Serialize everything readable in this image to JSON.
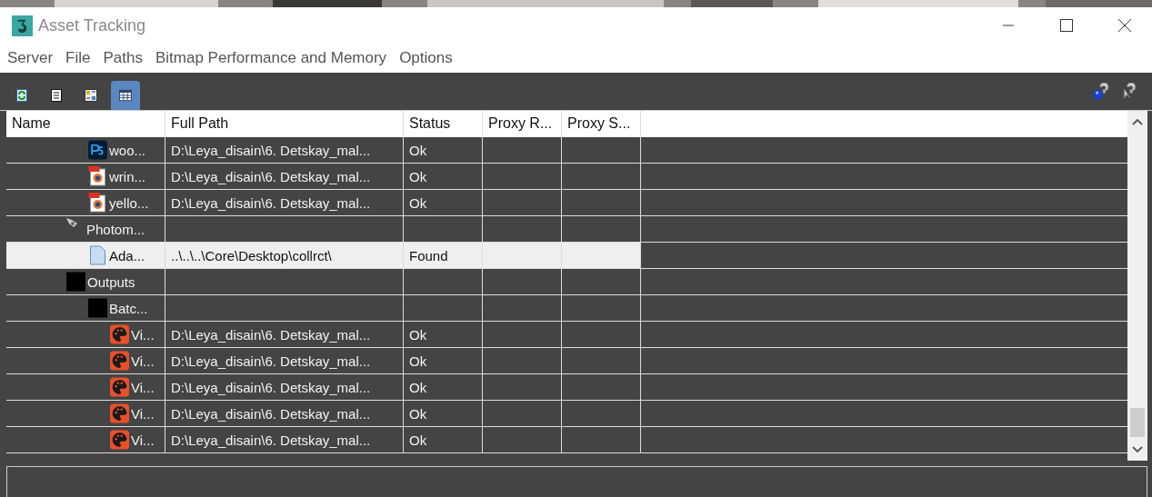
{
  "window": {
    "title": "Asset Tracking"
  },
  "menu": [
    "Server",
    "File",
    "Paths",
    "Bitmap Performance and Memory",
    "Options"
  ],
  "toolbar": [
    {
      "kind": "refresh",
      "selected": false
    },
    {
      "kind": "list",
      "selected": false
    },
    {
      "kind": "thumbnails",
      "selected": false
    },
    {
      "kind": "grid",
      "selected": true
    }
  ],
  "help_buttons": [
    {
      "kind": "online-help"
    },
    {
      "kind": "context-help"
    }
  ],
  "table": {
    "columns": [
      "Name",
      "Full Path",
      "Status",
      "Proxy R...",
      "Proxy S..."
    ],
    "rows": [
      {
        "kind": "continued",
        "children": [
          {
            "kind": "photoshop",
            "name": "woo...",
            "path": "D:\\Leya_disain\\6. Detskay_mal...",
            "status": "Ok",
            "selected": false
          },
          {
            "kind": "jpeg",
            "name": "wrin...",
            "path": "D:\\Leya_disain\\6. Detskay_mal...",
            "status": "Ok",
            "selected": false
          },
          {
            "kind": "jpeg",
            "name": "yello...",
            "path": "D:\\Leya_disain\\6. Detskay_mal...",
            "status": "Ok",
            "selected": false
          }
        ]
      },
      {
        "kind": "photometric",
        "name": "Photom...",
        "selected": false,
        "children": [
          {
            "kind": "document",
            "name": "Ada...",
            "path": "..\\..\\..\\Core\\Desktop\\collrct\\",
            "status": "Found",
            "selected": true
          }
        ]
      },
      {
        "kind": "black",
        "name": "Outputs",
        "selected": false,
        "children": [
          {
            "kind": "black",
            "name": "Batc...",
            "selected": false,
            "children": [
              {
                "kind": "palette",
                "name": "Vi...",
                "path": "D:\\Leya_disain\\6. Detskay_mal...",
                "status": "Ok",
                "selected": false
              },
              {
                "kind": "palette",
                "name": "Vi...",
                "path": "D:\\Leya_disain\\6. Detskay_mal...",
                "status": "Ok",
                "selected": false
              },
              {
                "kind": "palette",
                "name": "Vi...",
                "path": "D:\\Leya_disain\\6. Detskay_mal...",
                "status": "Ok",
                "selected": false
              },
              {
                "kind": "palette",
                "name": "Vi...",
                "path": "D:\\Leya_disain\\6. Detskay_mal...",
                "status": "Ok",
                "selected": false
              },
              {
                "kind": "palette",
                "name": "Vi...",
                "path": "D:\\Leya_disain\\6. Detskay_mal...",
                "status": "Ok",
                "selected": false
              }
            ]
          }
        ]
      }
    ]
  }
}
